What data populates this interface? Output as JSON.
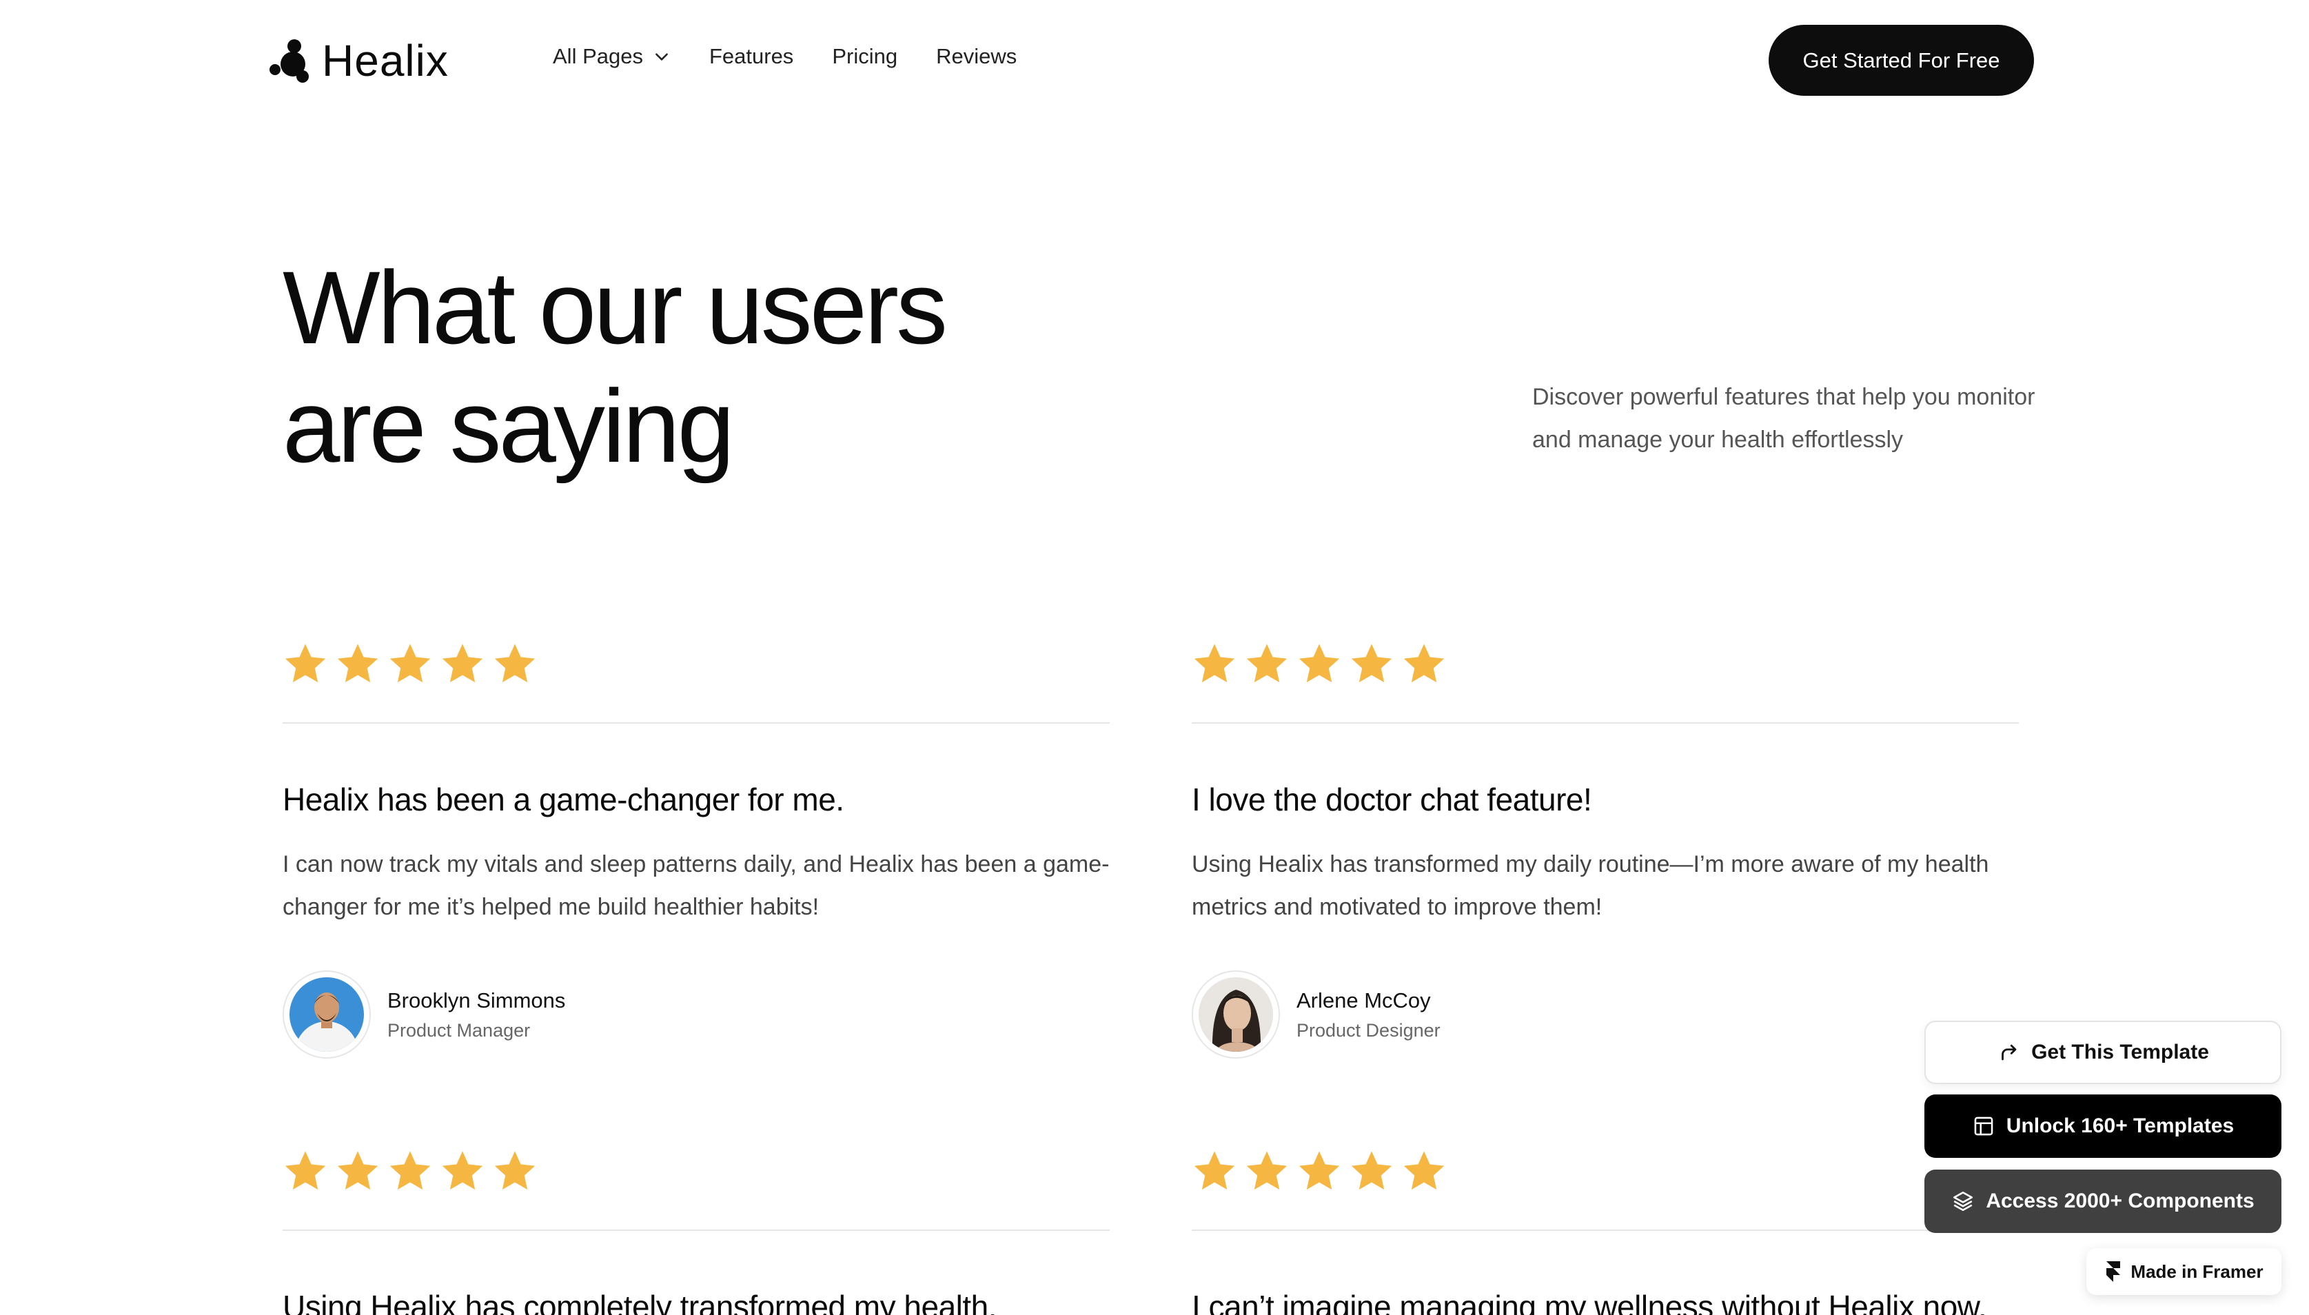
{
  "header": {
    "logo_text": "Healix",
    "nav": [
      {
        "label": "All Pages",
        "has_dropdown": true
      },
      {
        "label": "Features"
      },
      {
        "label": "Pricing"
      },
      {
        "label": "Reviews"
      }
    ],
    "cta_label": "Get Started For Free"
  },
  "hero": {
    "title_line1": "What our users",
    "title_line2": "are saying",
    "subtitle": "Discover powerful features that help you monitor and manage your health effortlessly"
  },
  "reviews": [
    {
      "rating": 5,
      "title": "Healix has been a game-changer for me.",
      "body": "I can now track my vitals and sleep patterns daily, and Healix has been a game-changer for me it’s helped me build healthier habits!",
      "name": "Brooklyn Simmons",
      "role": "Product Manager"
    },
    {
      "rating": 5,
      "title": "I love the doctor chat feature!",
      "body": "Using Healix has transformed my daily routine—I’m more aware of my health metrics and motivated to improve them!",
      "name": "Arlene McCoy",
      "role": "Product Designer"
    },
    {
      "rating": 5,
      "title": "Using Healix has completely transformed my health."
    },
    {
      "rating": 5,
      "title": "I can’t imagine managing my wellness without Healix now."
    }
  ],
  "floating": {
    "get_template": "Get This Template",
    "unlock_templates": "Unlock 160+ Templates",
    "access_components": "Access 2000+ Components",
    "made_in_framer": "Made in Framer"
  },
  "colors": {
    "star": "#F5B742",
    "primary": "#0D0D0D",
    "muted_button": "#404040"
  },
  "icons": {
    "logo": "healix-molecule-icon",
    "dropdown": "chevron-down-icon",
    "get_template": "share-arrow-icon",
    "unlock": "layout-icon",
    "access": "layers-icon",
    "framer": "framer-icon",
    "rating": "star-icon"
  }
}
